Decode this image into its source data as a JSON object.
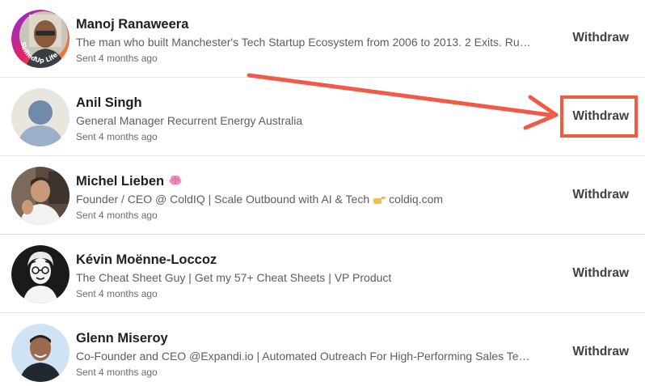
{
  "invitations": [
    {
      "name": "Manoj Ranaweera",
      "headline": "The man who built Manchester's Tech Startup Ecosystem from 2006 to 2013. 2 Exits. Runs:...",
      "sent": "Sent 4 months ago",
      "action": "Withdraw",
      "avatar_badge": "SkilledUp Life"
    },
    {
      "name": "Anil Singh",
      "headline": "General Manager Recurrent Energy Australia",
      "sent": "Sent 4 months ago",
      "action": "Withdraw"
    },
    {
      "name": "Michel Lieben",
      "headline_part1": "Founder / CEO @ ColdIQ | Scale Outbound with AI & Tech",
      "headline_part2": "coldiq.com",
      "sent": "Sent 4 months ago",
      "action": "Withdraw"
    },
    {
      "name": "Kévin Moënne-Loccoz",
      "headline": "The Cheat Sheet Guy | Get my 57+ Cheat Sheets | VP Product",
      "sent": "Sent 4 months ago",
      "action": "Withdraw"
    },
    {
      "name": "Glenn Miseroy",
      "headline": "Co-Founder and CEO @Expandi.io | Automated Outreach For High-Performing Sales Teams",
      "sent": "Sent 4 months ago",
      "action": "Withdraw"
    }
  ],
  "icons": {
    "name_emoji": "brain-emoji-icon",
    "headline_emoji": "pointing-hand-emoji-icon"
  },
  "colors": {
    "annotation": "#f25a48",
    "action_text": "#404040",
    "divider": "#e3e3e3"
  }
}
